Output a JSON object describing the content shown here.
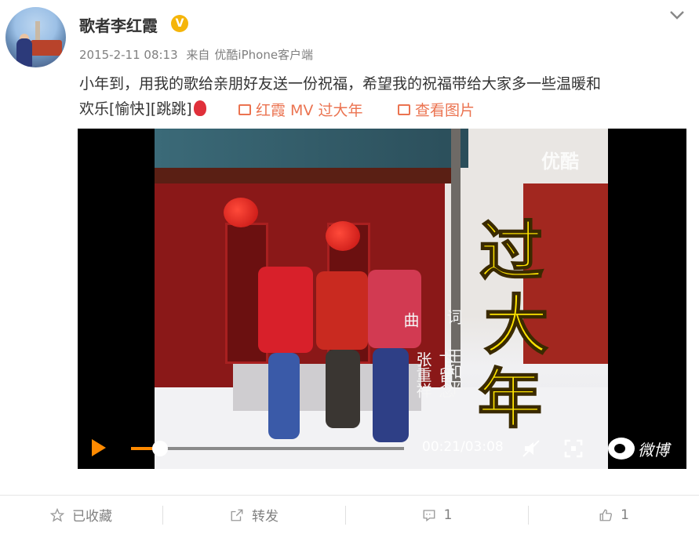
{
  "post": {
    "username": "歌者李红霞",
    "verified_badge": "V",
    "date": "2015-2-11 08:13",
    "source_prefix": "来自",
    "source": "优酷iPhone客户端",
    "text_line1": "小年到，用我的歌给亲朋好友送一份祝福，希望我的祝福带给大家多一些温暖和",
    "text_line2": "欢乐[愉快][跳跳]",
    "video_link": "红霞 MV 过大年",
    "image_link": "查看图片"
  },
  "video": {
    "watermark": "优酷",
    "title_chars": [
      "过",
      "大",
      "年"
    ],
    "credits": {
      "lyrics_label": "词",
      "lyrics_author": "王和平",
      "music_label": "曲",
      "music_author": "卞留念 张重祥"
    },
    "progress": 0.105,
    "time": "00:21/03:08",
    "brand": "微博"
  },
  "actions": {
    "favorite": "已收藏",
    "repost": "转发",
    "comment_count": "1",
    "like_count": "1"
  },
  "colors": {
    "accent": "#eb7350",
    "progress": "#ff8a00",
    "badge": "#f5b50a"
  }
}
